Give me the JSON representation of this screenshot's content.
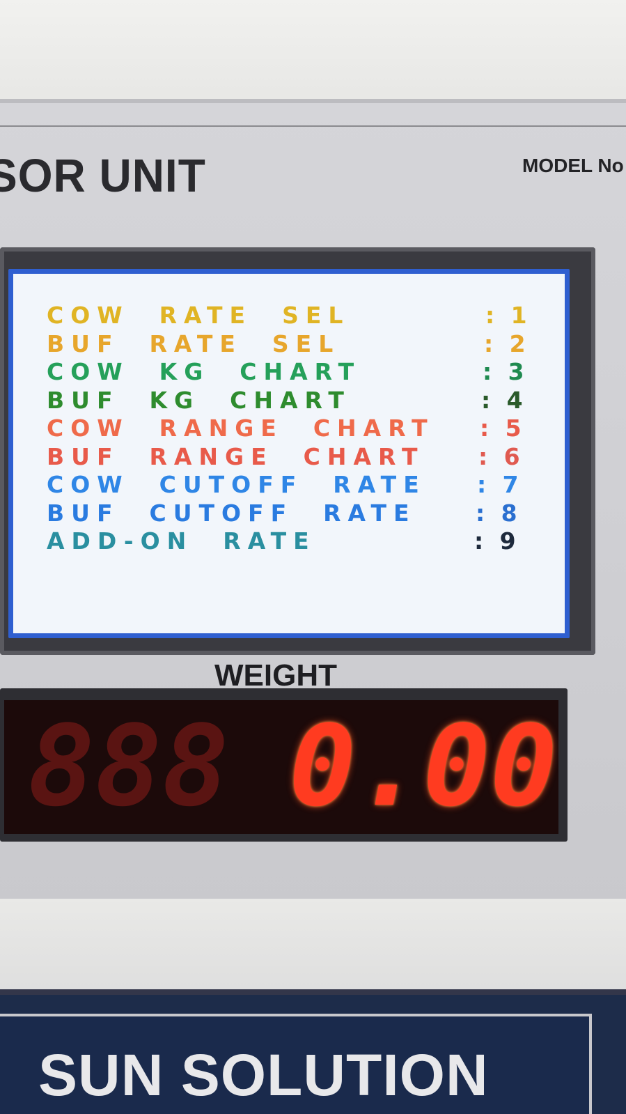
{
  "header": {
    "unit_title": "SOR UNIT",
    "model_label": "MODEL No"
  },
  "menu": {
    "items": [
      {
        "label": "COW  RATE  SEL",
        "key": ": 1",
        "color": "#e0b424"
      },
      {
        "label": "BUF  RATE  SEL",
        "key": ": 2",
        "color": "#e7a62c"
      },
      {
        "label": "COW  KG  CHART",
        "key": ": 3",
        "color": "#25a05a"
      },
      {
        "label": "BUF  KG  CHART",
        "key": ": 4",
        "color": "#2e8c2e"
      },
      {
        "label": "COW  RANGE  CHART",
        "key": ": 5",
        "color": "#ef6a4a"
      },
      {
        "label": "BUF  RANGE  CHART",
        "key": ": 6",
        "color": "#e85a4a"
      },
      {
        "label": "COW  CUTOFF  RATE",
        "key": ": 7",
        "color": "#2f86e6"
      },
      {
        "label": "BUF  CUTOFF  RATE",
        "key": ": 8",
        "color": "#2a7be0"
      },
      {
        "label": "ADD-ON  RATE",
        "key": ": 9",
        "color": "#2a8fa0"
      }
    ],
    "key_colors": [
      "#e0b424",
      "#e7a62c",
      "#1f8a50",
      "#2a5a2a",
      "#e85a4a",
      "#e05a50",
      "#2f86e6",
      "#2a6fd0",
      "#1e2a3c"
    ]
  },
  "weight": {
    "label": "WEIGHT",
    "dim_digits": "888",
    "value": "0.00"
  },
  "brand": {
    "name": "SUN SOLUTION"
  },
  "colors": {
    "lcd_border": "#2f5fd0",
    "lcd_background": "#f2f6fb",
    "segment_lit": "#ff3b20",
    "segment_dim": "#5a1412"
  }
}
